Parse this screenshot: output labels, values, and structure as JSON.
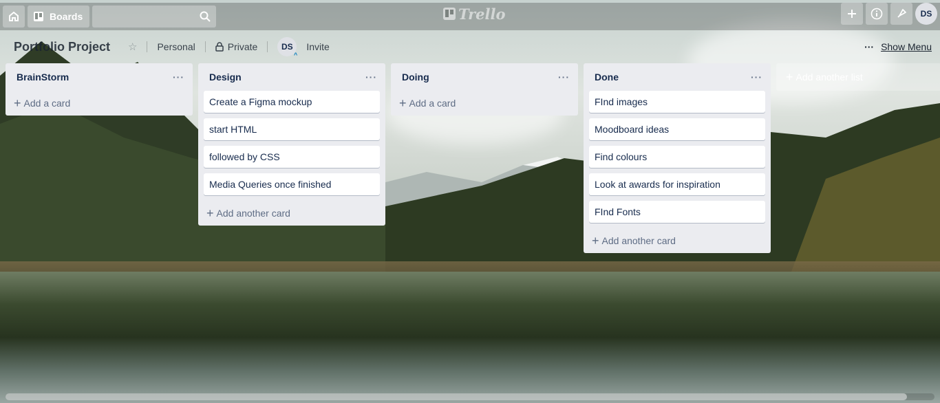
{
  "header": {
    "boards_label": "Boards",
    "search_value": "",
    "logo_text": "Trello",
    "avatar_initials": "DS"
  },
  "board": {
    "title": "Portfolio Project",
    "team": "Personal",
    "visibility": "Private",
    "member_initials": "DS",
    "invite_label": "Invite",
    "show_menu_label": "Show Menu",
    "more_dots": "···"
  },
  "lists": [
    {
      "title": "BrainStorm",
      "menu": "···",
      "cards": [],
      "add_label": "Add a card"
    },
    {
      "title": "Design",
      "menu": "···",
      "cards": [
        "Create a Figma mockup",
        "start HTML",
        "followed by CSS",
        "Media Queries once finished"
      ],
      "add_label": "Add another card"
    },
    {
      "title": "Doing",
      "menu": "···",
      "cards": [],
      "add_label": "Add a card"
    },
    {
      "title": "Done",
      "menu": "···",
      "cards": [
        "FInd images",
        "Moodboard ideas",
        "Find colours",
        "Look at awards for inspiration",
        "FInd Fonts"
      ],
      "add_label": "Add another card"
    }
  ],
  "add_list_label": "Add another list",
  "icons": {
    "home": "home-icon",
    "boards": "boards-icon",
    "search": "search-icon",
    "add": "plus-icon",
    "info": "info-icon",
    "notifications": "notification-icon",
    "lock": "lock-icon"
  }
}
